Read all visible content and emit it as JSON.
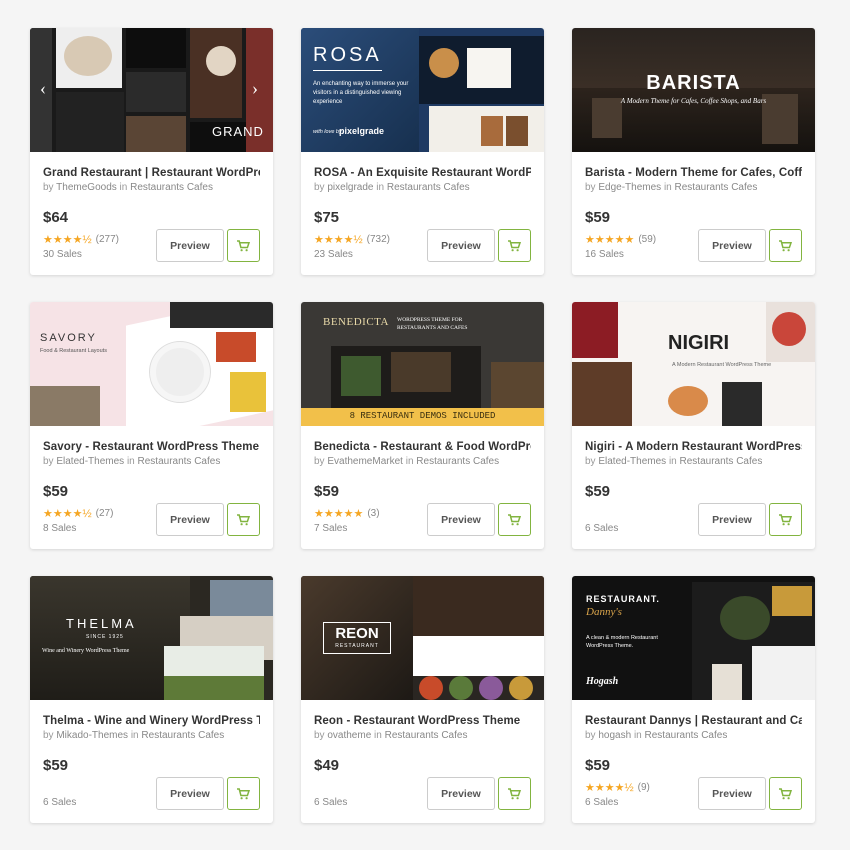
{
  "products": [
    {
      "id": "grand",
      "title": "Grand Restaurant | Restaurant WordPress Theme",
      "by": "by",
      "author": "ThemeGoods",
      "in": "in",
      "category": "Restaurants Cafes",
      "price": "$64",
      "stars": "★★★★½",
      "reviews": "(277)",
      "sales": "30 Sales",
      "thumb_text": "GRAND"
    },
    {
      "id": "rosa",
      "title": "ROSA - An Exquisite Restaurant WordPress Theme",
      "by": "by",
      "author": "pixelgrade",
      "in": "in",
      "category": "Restaurants Cafes",
      "price": "$75",
      "stars": "★★★★½",
      "reviews": "(732)",
      "sales": "23 Sales",
      "thumb_text": "ROSA",
      "thumb_sub": "An enchanting way to immerse your visitors in a distinguished viewing experience",
      "thumb_brand": "pixelgrade",
      "thumb_love": "with love by"
    },
    {
      "id": "barista",
      "title": "Barista - Modern Theme for Cafes, Coffee Shops",
      "by": "by",
      "author": "Edge-Themes",
      "in": "in",
      "category": "Restaurants Cafes",
      "price": "$59",
      "stars": "★★★★★",
      "reviews": "(59)",
      "sales": "16 Sales",
      "thumb_text": "BARISTA",
      "thumb_sub": "A Modern Theme for Cafes, Coffee Shops, and Bars"
    },
    {
      "id": "savory",
      "title": "Savory - Restaurant WordPress Theme",
      "by": "by",
      "author": "Elated-Themes",
      "in": "in",
      "category": "Restaurants Cafes",
      "price": "$59",
      "stars": "★★★★½",
      "reviews": "(27)",
      "sales": "8 Sales",
      "thumb_text": "SAVORY",
      "thumb_sub": "Food & Restaurant Layouts"
    },
    {
      "id": "benedicta",
      "title": "Benedicta - Restaurant & Food WordPress Theme",
      "by": "by",
      "author": "EvathemeMarket",
      "in": "in",
      "category": "Restaurants Cafes",
      "price": "$59",
      "stars": "★★★★★",
      "reviews": "(3)",
      "sales": "7 Sales",
      "thumb_text": "BENEDICTA",
      "thumb_sub": "WORDPRESS THEME FOR RESTAURANTS AND CAFES",
      "thumb_banner": "8 RESTAURANT DEMOS INCLUDED"
    },
    {
      "id": "nigiri",
      "title": "Nigiri - A Modern Restaurant WordPress Theme",
      "by": "by",
      "author": "Elated-Themes",
      "in": "in",
      "category": "Restaurants Cafes",
      "price": "$59",
      "stars": "",
      "reviews": "",
      "sales": "6 Sales",
      "thumb_text": "NIGIRI",
      "thumb_sub": "A Modern Restaurant WordPress Theme"
    },
    {
      "id": "thelma",
      "title": "Thelma - Wine and Winery WordPress Theme",
      "by": "by",
      "author": "Mikado-Themes",
      "in": "in",
      "category": "Restaurants Cafes",
      "price": "$59",
      "stars": "",
      "reviews": "",
      "sales": "6 Sales",
      "thumb_text": "THELMA",
      "thumb_since": "SINCE 1925",
      "thumb_sub": "Wine and Winery WordPress Theme"
    },
    {
      "id": "reon",
      "title": "Reon - Restaurant WordPress Theme",
      "by": "by",
      "author": "ovatheme",
      "in": "in",
      "category": "Restaurants Cafes",
      "price": "$49",
      "stars": "",
      "reviews": "",
      "sales": "6 Sales",
      "thumb_text": "REON",
      "thumb_sub": "RESTAURANT"
    },
    {
      "id": "dannys",
      "title": "Restaurant Dannys | Restaurant and Cafe WordPress Theme",
      "by": "by",
      "author": "hogash",
      "in": "in",
      "category": "Restaurants Cafes",
      "price": "$59",
      "stars": "★★★★½",
      "reviews": "(9)",
      "sales": "6 Sales",
      "thumb_text": "RESTAURANT.",
      "thumb_script": "Danny's",
      "thumb_sub": "A clean & modern Restaurant WordPress Theme.",
      "thumb_brand": "Hogash"
    }
  ],
  "buttons": {
    "preview_label": "Preview"
  },
  "icons": {
    "cart": "cart-icon",
    "star": "star-icon"
  },
  "colors": {
    "accent_green": "#82b440",
    "star": "#f5a623"
  }
}
